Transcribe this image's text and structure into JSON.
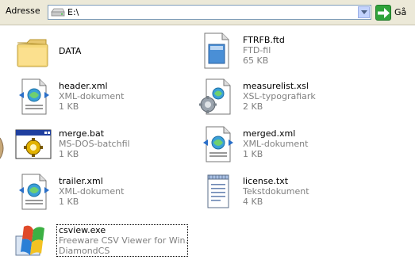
{
  "address": {
    "label": "Adresse",
    "value": "E:\\",
    "go_label": "Gå"
  },
  "items": [
    {
      "name": "DATA",
      "type": "",
      "size": "",
      "icon": "folder-icon"
    },
    {
      "name": "FTRFB.ftd",
      "type": "FTD-fil",
      "size": "65 KB",
      "icon": "ftd-file-icon"
    },
    {
      "name": "header.xml",
      "type": "XML-dokument",
      "size": "1 KB",
      "icon": "xml-file-icon"
    },
    {
      "name": "measurelist.xsl",
      "type": "XSL-typografiark",
      "size": "2 KB",
      "icon": "xsl-file-icon"
    },
    {
      "name": "merge.bat",
      "type": "MS-DOS-batchfil",
      "size": "1 KB",
      "icon": "batch-file-icon"
    },
    {
      "name": "merged.xml",
      "type": "XML-dokument",
      "size": "1 KB",
      "icon": "xml-file-icon"
    },
    {
      "name": "trailer.xml",
      "type": "XML-dokument",
      "size": "1 KB",
      "icon": "xml-file-icon"
    },
    {
      "name": "license.txt",
      "type": "Tekstdokument",
      "size": "4 KB",
      "icon": "text-file-icon"
    },
    {
      "name": "csview.exe",
      "type": "Freeware CSV Viewer for Win...",
      "size": "DiamondCS",
      "icon": "csview-app-icon"
    }
  ]
}
